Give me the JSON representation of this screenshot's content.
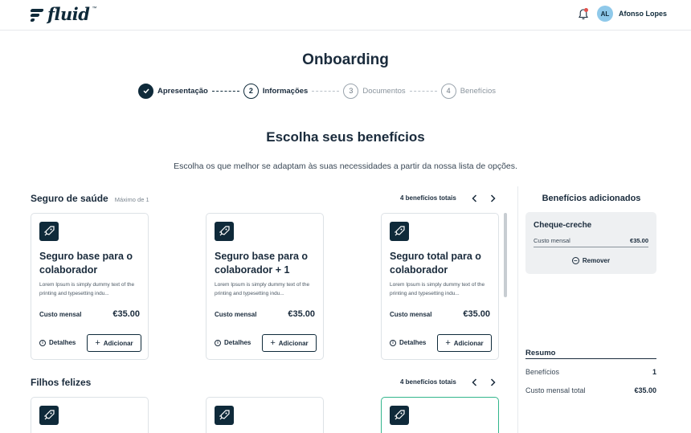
{
  "header": {
    "logo_text": "fluid",
    "logo_tm": "™",
    "user_initials": "AL",
    "user_name": "Afonso Lopes"
  },
  "page_title": "Onboarding",
  "stepper": [
    {
      "number": "✓",
      "label": "Apresentação",
      "state": "done"
    },
    {
      "number": "2",
      "label": "Informações",
      "state": "active"
    },
    {
      "number": "3",
      "label": "Documentos",
      "state": "pending"
    },
    {
      "number": "4",
      "label": "Benefícios",
      "state": "pending"
    }
  ],
  "section": {
    "heading": "Escolha seus benefícios",
    "subtitle": "Escolha os que melhor se adaptam às suas necessidades a partir da nossa lista de opções."
  },
  "categories": [
    {
      "title": "Seguro de saúde",
      "max": "Máximo de 1",
      "total": "4 benefícios totais",
      "cards": [
        {
          "title": "Seguro base para o colaborador",
          "desc": "Lorem Ipsum is simply dummy text of the printing and typesetting indu...",
          "cost_label": "Custo mensal",
          "cost": "€35.00",
          "details": "Detalhes",
          "add": "Adicionar"
        },
        {
          "title": "Seguro base para o colaborador + 1",
          "desc": "Lorem Ipsum is simply dummy text of the printing and typesetting indu...",
          "cost_label": "Custo mensal",
          "cost": "€35.00",
          "details": "Detalhes",
          "add": "Adicionar"
        },
        {
          "title": "Seguro total para o colaborador",
          "desc": "Lorem Ipsum is simply dummy text of the printing and typesetting indu...",
          "cost_label": "Custo mensal",
          "cost": "€35.00",
          "details": "Detalhes",
          "add": "Adicionar"
        }
      ]
    },
    {
      "title": "Filhos felizes",
      "total": "4 benefícios totais"
    }
  ],
  "panel": {
    "title": "Benefícios adicionados",
    "added": {
      "name": "Cheque-creche",
      "cost_label": "Custo mensal",
      "cost": "€35.00",
      "remove": "Remover"
    },
    "summary": {
      "title": "Resumo",
      "benefits_label": "Benefícios",
      "benefits_value": "1",
      "total_label": "Custo mensal total",
      "total_value": "€35.00"
    }
  },
  "colors": {
    "primary": "#0f2a3a",
    "selected_border": "#33b58c",
    "notification": "#e2504c",
    "avatar": "#8fc9ea"
  }
}
